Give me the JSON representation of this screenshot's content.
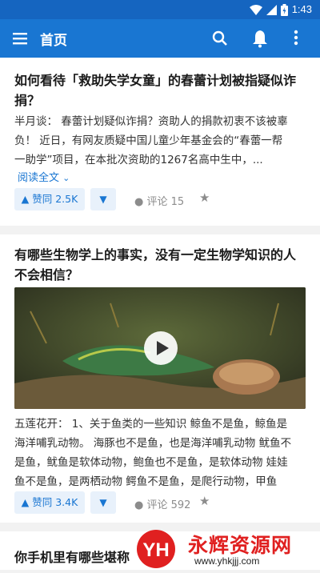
{
  "status_bar": {
    "time": "1:43"
  },
  "app_bar": {
    "title": "首页",
    "icons": [
      "menu-icon",
      "search-icon",
      "bell-icon",
      "more-vert-icon"
    ]
  },
  "feed": [
    {
      "title_line1": "如何看待「救助失学女童」的春蕾计划被指疑似诈",
      "title_line2": "捐？",
      "excerpt_line1": "半月谈： 春蕾计划疑似诈捐？资助人的捐款初衷不该被辜",
      "excerpt_line2": "负！ 近日，有网友质疑中国儿童少年基金会的“春蕾一帮",
      "excerpt_line3": "一助学”项目，在本批次资助的1267名高中生中，...",
      "read_all": "阅读全文",
      "vote_label": "▲ 赞同 2.5K",
      "comment_label": "评论 15"
    },
    {
      "title_line1": "有哪些生物学上的事实，没有一定生物学知识的人",
      "title_line2": "不会相信？",
      "excerpt_line1": "五莲花开： 1、关于鱼类的一些知识 鲸鱼不是鱼，鲸鱼是",
      "excerpt_line2": "海洋哺乳动物。 海豚也不是鱼，也是海洋哺乳动物 鱿鱼不",
      "excerpt_line3": "是鱼，鱿鱼是软体动物，鲍鱼也不是鱼，是软体动物 娃娃",
      "excerpt_line4": "鱼不是鱼，是两栖动物 鳄鱼不是鱼，是爬行动物，甲鱼",
      "vote_label": "▲ 赞同 3.4K",
      "comment_label": "评论 592"
    },
    {
      "title_partial": "你手机里有哪些堪称"
    }
  ],
  "watermark": {
    "logo_text": "YH",
    "name": "永辉资源网",
    "url": "www.yhkjjj.com"
  },
  "colors": {
    "primary": "#1976d2",
    "status_bar": "#1565c0",
    "watermark_red": "#e02020"
  }
}
